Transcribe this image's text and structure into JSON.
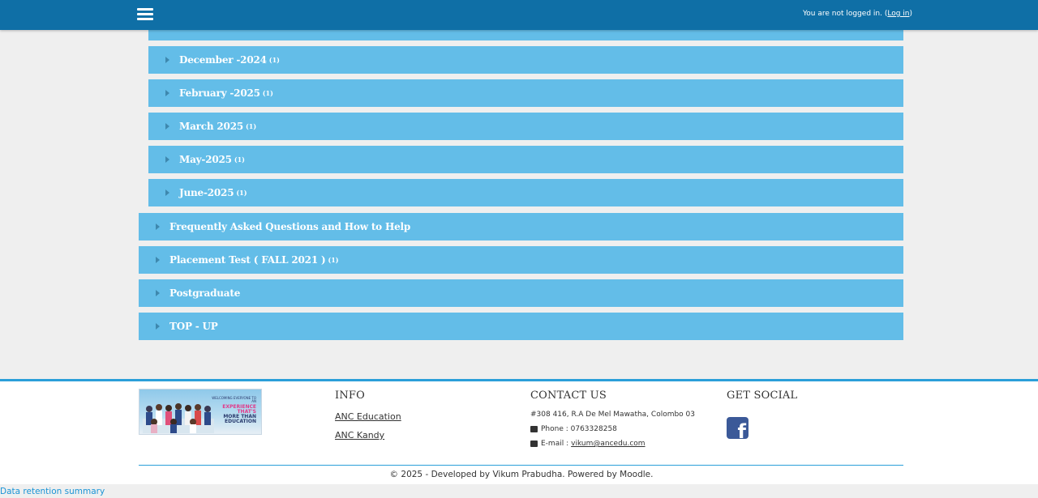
{
  "navbar": {
    "menu_icon": "hamburger-icon",
    "login_text": "You are not logged in. (",
    "login_link": "Log in",
    "login_close": ")"
  },
  "categories": [
    {
      "name": "December -2024",
      "count": "(1)"
    },
    {
      "name": "February -2025",
      "count": "(1)"
    },
    {
      "name": "March 2025",
      "count": "(1)"
    },
    {
      "name": "May-2025",
      "count": "(1)"
    },
    {
      "name": "June-2025",
      "count": "(1)"
    },
    {
      "name": "Frequently Asked Questions and How to Help",
      "count": ""
    },
    {
      "name": "Placement Test ( FALL 2021 )",
      "count": "(1)"
    },
    {
      "name": "Postgraduate",
      "count": ""
    },
    {
      "name": "TOP - UP",
      "count": ""
    }
  ],
  "footer": {
    "banner": {
      "line1": "WELCOMING EVERYONE TO AN",
      "line2": "EXPERIENCE THAT'S",
      "line3": "MORE THAN",
      "line4": "EDUCATION"
    },
    "info": {
      "heading": "INFO",
      "links": [
        "ANC Education",
        "ANC Kandy"
      ]
    },
    "contact": {
      "heading": "CONTACT US",
      "address": "#308 416, R.A De Mel Mawatha, Colombo 03",
      "phone": "Phone : 0763328258",
      "email_label": "E-mail :",
      "email": "vikum@ancedu.com"
    },
    "social": {
      "heading": "GET SOCIAL",
      "icon": "facebook-icon"
    },
    "copyright": "© 2025 - Developed by Vikum Prabudha. Powered by Moodle."
  },
  "data_retention": "Data retention summary",
  "colors": {
    "navbar": "#0f6fa6",
    "category": "#63bde8",
    "accent": "#2b9fd9",
    "link": "#1a94d6"
  }
}
